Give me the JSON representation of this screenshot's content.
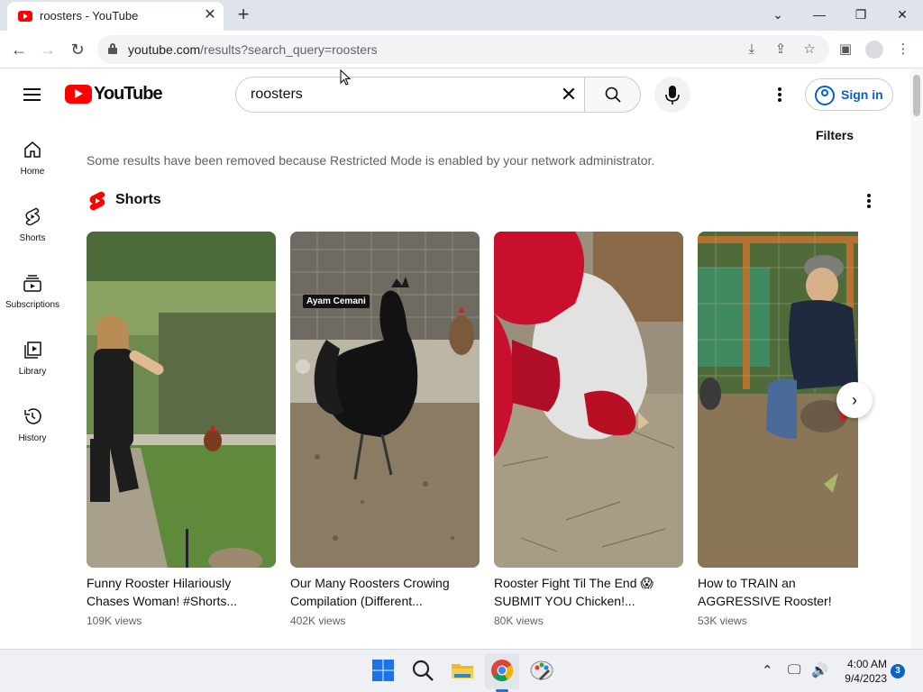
{
  "browser": {
    "tab_title": "roosters - YouTube",
    "url_domain": "youtube.com",
    "url_path": "/results?search_query=roosters"
  },
  "youtube": {
    "wordmark": "YouTube",
    "search_query": "roosters",
    "signin_label": "Sign in",
    "filters_label": "Filters",
    "restricted_notice": "Some results have been removed because Restricted Mode is enabled by your network administrator.",
    "shelf_title": "Shorts"
  },
  "guide": [
    {
      "label": "Home",
      "icon": "home-icon"
    },
    {
      "label": "Shorts",
      "icon": "shorts-icon"
    },
    {
      "label": "Subscriptions",
      "icon": "subscriptions-icon"
    },
    {
      "label": "Library",
      "icon": "library-icon"
    },
    {
      "label": "History",
      "icon": "history-icon"
    }
  ],
  "shorts": [
    {
      "title_line1": "Funny Rooster Hilariously",
      "title_line2": "Chases Woman! #Shorts...",
      "views": "109K views"
    },
    {
      "title_line1": "Our Many Roosters Crowing",
      "title_line2": "Compilation (Different...",
      "views": "402K views",
      "overlay": "Ayam Cemani"
    },
    {
      "title_line1": "Rooster Fight Til The End 😱",
      "title_line2": "SUBMIT YOU Chicken!...",
      "views": "80K views"
    },
    {
      "title_line1": "How to TRAIN an",
      "title_line2": "AGGRESSIVE Rooster!",
      "views": "53K views"
    }
  ],
  "taskbar": {
    "time": "4:00 AM",
    "date": "9/4/2023",
    "notification_count": "3"
  },
  "colors": {
    "youtube_red": "#ff0000",
    "link_blue": "#065fd4"
  }
}
